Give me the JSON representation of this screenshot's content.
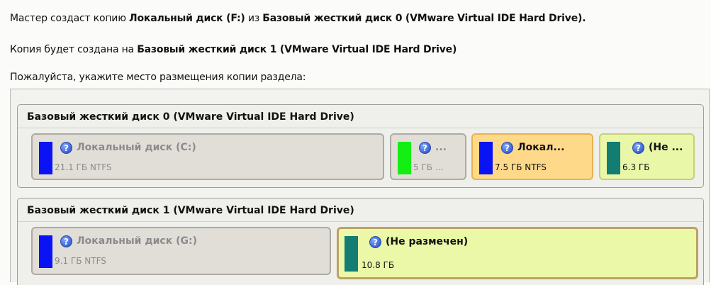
{
  "header": {
    "line1_prefix": "Мастер создаст копию ",
    "line1_source": "Локальный диск (F:)",
    "line1_mid": " из ",
    "line1_disk": "Базовый жесткий диск 0 (VMware Virtual IDE Hard Drive).",
    "line2_prefix": "Копия будет создана на ",
    "line2_disk": "Базовый жесткий диск 1 (VMware Virtual IDE Hard Drive)",
    "line3": "Пожалуйста, укажите место размещения копии раздела:"
  },
  "disks": [
    {
      "title": "Базовый жесткий диск 0 (VMware Virtual IDE Hard Drive)",
      "partitions": [
        {
          "name": "Локальный диск (C:)",
          "info": "21.1 ГБ NTFS",
          "color": "#0a13f4",
          "icon": "help-icon",
          "state": "normal"
        },
        {
          "name": "...",
          "info": "5 ГБ ...",
          "color": "#13ef13",
          "icon": "help-icon",
          "state": "normal"
        },
        {
          "name": "Локал...",
          "info": "7.5 ГБ NTFS",
          "color": "#0a13f4",
          "icon": "help-icon",
          "state": "selected"
        },
        {
          "name": "(Не ...",
          "info": "6.3 ГБ",
          "color": "#137d73",
          "icon": "help-icon",
          "state": "free"
        }
      ]
    },
    {
      "title": "Базовый жесткий диск 1 (VMware Virtual IDE Hard Drive)",
      "partitions": [
        {
          "name": "Локальный диск (G:)",
          "info": "9.1 ГБ NTFS",
          "color": "#0a13f4",
          "icon": "help-icon",
          "state": "normal"
        },
        {
          "name": "(Не размечен)",
          "info": "10.8 ГБ",
          "color": "#137d73",
          "icon": "help-icon",
          "state": "target"
        }
      ]
    }
  ]
}
